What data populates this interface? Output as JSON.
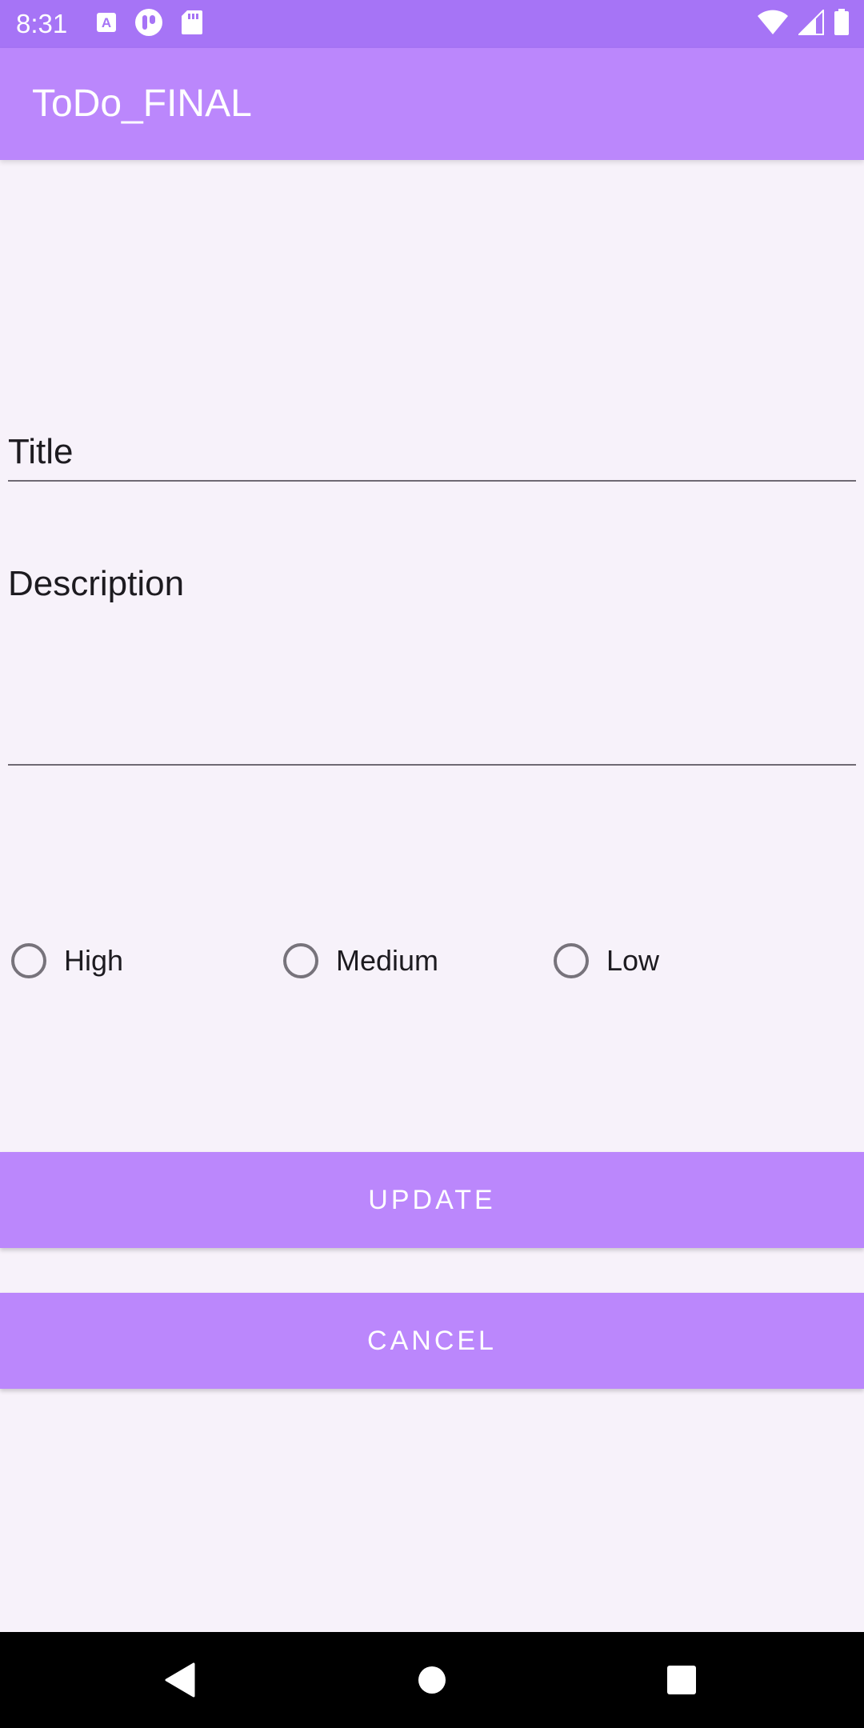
{
  "status_bar": {
    "time": "8:31",
    "left_icons": [
      "a-font-icon",
      "tracker-icon",
      "sd-card-icon"
    ],
    "right_icons": [
      "wifi-icon",
      "cell-signal-icon",
      "battery-icon"
    ],
    "background_color": "#a674f6"
  },
  "app_bar": {
    "title": "ToDo_FINAL",
    "background_color": "#bb87fc"
  },
  "form": {
    "title_placeholder": "Title",
    "title_value": "",
    "description_placeholder": "Description",
    "description_value": ""
  },
  "priority": {
    "options": [
      {
        "label": "High",
        "checked": false
      },
      {
        "label": "Medium",
        "checked": false
      },
      {
        "label": "Low",
        "checked": false
      }
    ]
  },
  "buttons": {
    "update_label": "UPDATE",
    "cancel_label": "CANCEL",
    "color": "#bb87fc"
  },
  "nav_bar": {
    "icons": [
      "back-icon",
      "home-icon",
      "recents-icon"
    ]
  }
}
